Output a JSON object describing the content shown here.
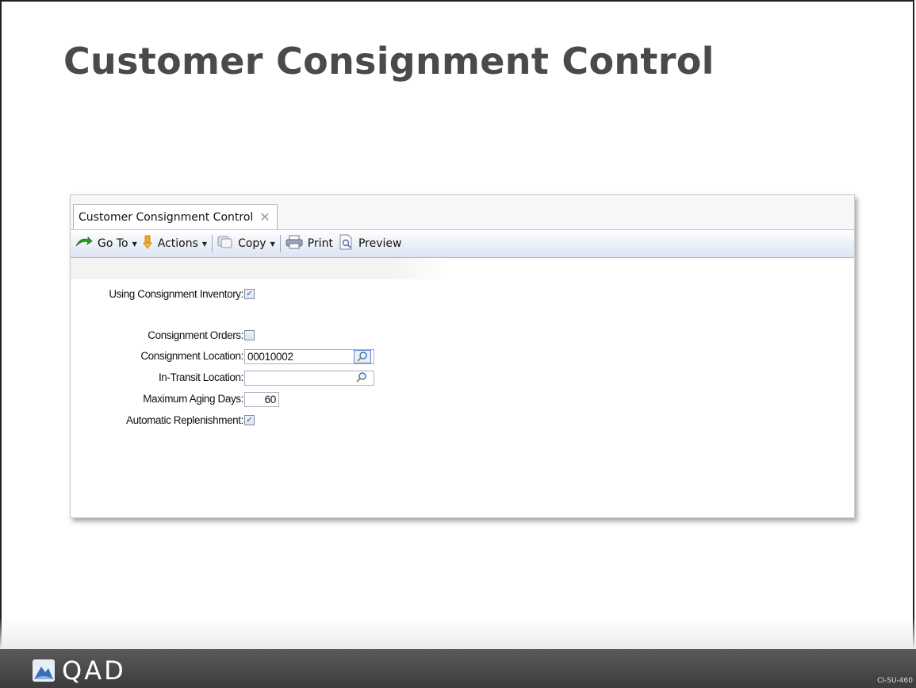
{
  "slide": {
    "title": "Customer Consignment Control",
    "code": "CI-SU-460",
    "logo_text": "QAD"
  },
  "window": {
    "tab_label": "Customer Consignment Control",
    "tab_close_icon": "close-icon",
    "toolbar": {
      "goto_label": "Go To",
      "actions_label": "Actions",
      "copy_label": "Copy",
      "print_label": "Print",
      "preview_label": "Preview"
    }
  },
  "form": {
    "using_consignment_label": "Using Consignment Inventory:",
    "using_consignment_checked": true,
    "consignment_orders_label": "Consignment Orders:",
    "consignment_orders_checked": false,
    "consignment_location_label": "Consignment Location:",
    "consignment_location_value": "00010002",
    "in_transit_location_label": "In-Transit Location:",
    "in_transit_location_value": "",
    "max_aging_days_label": "Maximum Aging Days:",
    "max_aging_days_value": "60",
    "auto_replenishment_label": "Automatic Replenishment:",
    "auto_replenishment_checked": true
  },
  "colors": {
    "title": "#4a4a4a",
    "footer": "#444444",
    "check": "#2a56a8"
  }
}
